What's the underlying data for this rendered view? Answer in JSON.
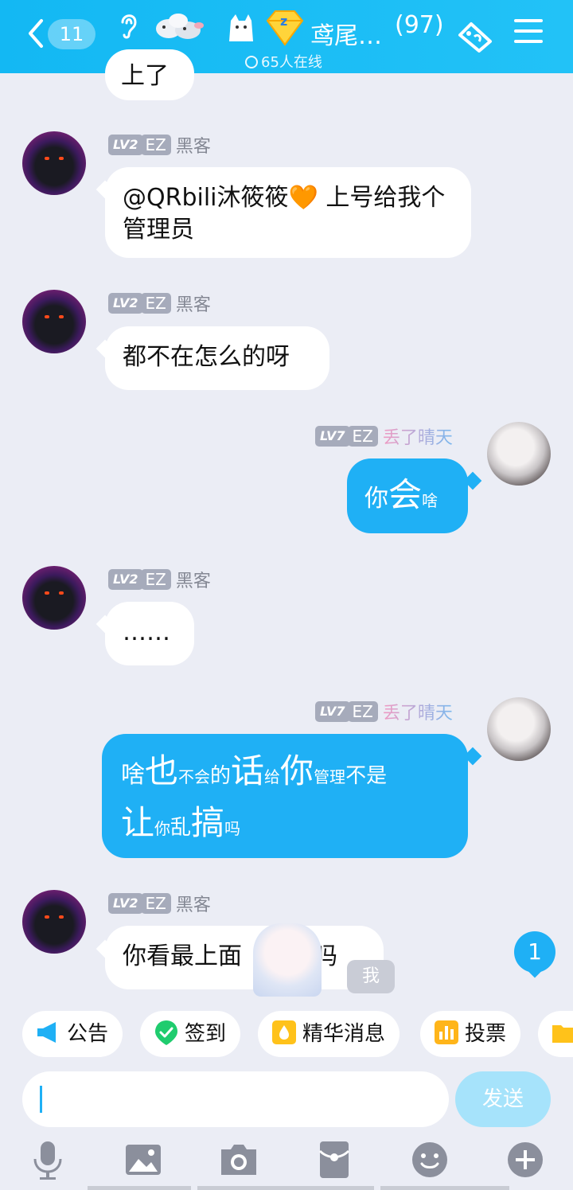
{
  "header": {
    "unread_count": "11",
    "title": "鸢尾…",
    "member_count": "(97)",
    "online": "65人在线"
  },
  "messages": [
    {
      "kind": "other",
      "lv": "LV2",
      "tag": "EZ",
      "nick": "黑客",
      "text": "@QRbili沐筱筱🧡 上号给我个管理员"
    },
    {
      "kind": "other",
      "lv": "LV2",
      "tag": "EZ",
      "nick": "黑客",
      "text": "都不在怎么的呀"
    },
    {
      "kind": "mine",
      "lv": "LV7",
      "tag": "EZ",
      "nick": "丢了晴天",
      "parts": [
        "你",
        "会",
        "啥"
      ]
    },
    {
      "kind": "other",
      "lv": "LV2",
      "tag": "EZ",
      "nick": "黑客",
      "text": "……"
    },
    {
      "kind": "mine",
      "lv": "LV7",
      "tag": "EZ",
      "nick": "丢了晴天",
      "parts": [
        "啥",
        "也",
        "不会",
        "的",
        "话",
        "给",
        "你",
        "管理",
        "不是",
        "让",
        "你",
        "乱",
        "搞",
        "吗"
      ]
    },
    {
      "kind": "other",
      "lv": "LV2",
      "tag": "EZ",
      "nick": "黑客",
      "text": "你看最上面",
      "text_after": "息吗"
    }
  ],
  "partial_top_text": "上了",
  "unread_badge": "1",
  "me_label": "我",
  "quick_actions": [
    {
      "label": "公告",
      "icon": "megaphone-icon"
    },
    {
      "label": "签到",
      "icon": "checkin-icon"
    },
    {
      "label": "精华消息",
      "icon": "essence-icon"
    },
    {
      "label": "投票",
      "icon": "vote-icon"
    }
  ],
  "send_label": "发送",
  "toolbar": [
    "mic-icon",
    "image-icon",
    "camera-icon",
    "red-packet-icon",
    "emoji-icon",
    "plus-icon"
  ],
  "colors": {
    "header": "#13b8f3",
    "accent": "#1fb0f5",
    "background": "#ebedf5"
  }
}
